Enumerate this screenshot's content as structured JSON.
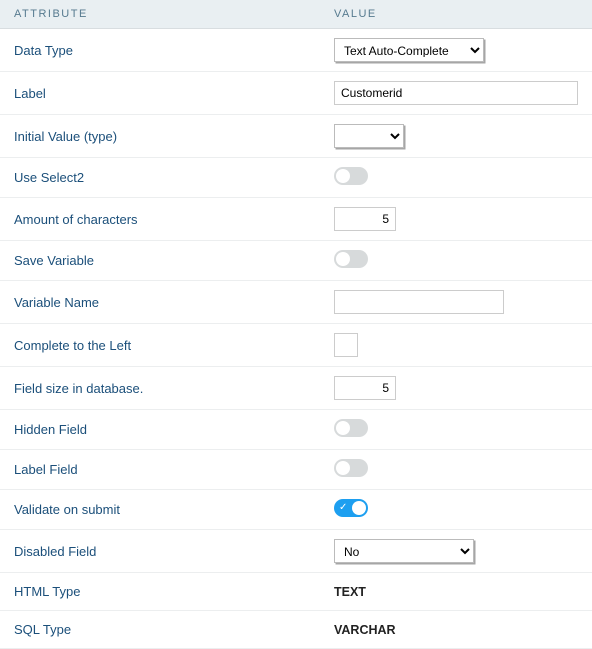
{
  "header": {
    "attribute": "ATTRIBUTE",
    "value": "VALUE"
  },
  "rows": {
    "dataType": {
      "label": "Data Type",
      "value": "Text Auto-Complete"
    },
    "label": {
      "label": "Label",
      "value": "Customerid"
    },
    "initialValue": {
      "label": "Initial Value (type)",
      "value": ""
    },
    "useSelect2": {
      "label": "Use Select2"
    },
    "amountChars": {
      "label": "Amount of characters",
      "value": "5"
    },
    "saveVariable": {
      "label": "Save Variable"
    },
    "variableName": {
      "label": "Variable Name",
      "value": ""
    },
    "completeLeft": {
      "label": "Complete to the Left",
      "value": ""
    },
    "fieldSize": {
      "label": "Field size in database.",
      "value": "5"
    },
    "hiddenField": {
      "label": "Hidden Field"
    },
    "labelField": {
      "label": "Label Field"
    },
    "validateSubmit": {
      "label": "Validate on submit"
    },
    "disabledField": {
      "label": "Disabled Field",
      "value": "No"
    },
    "htmlType": {
      "label": "HTML Type",
      "value": "TEXT"
    },
    "sqlType": {
      "label": "SQL Type",
      "value": "VARCHAR"
    }
  }
}
